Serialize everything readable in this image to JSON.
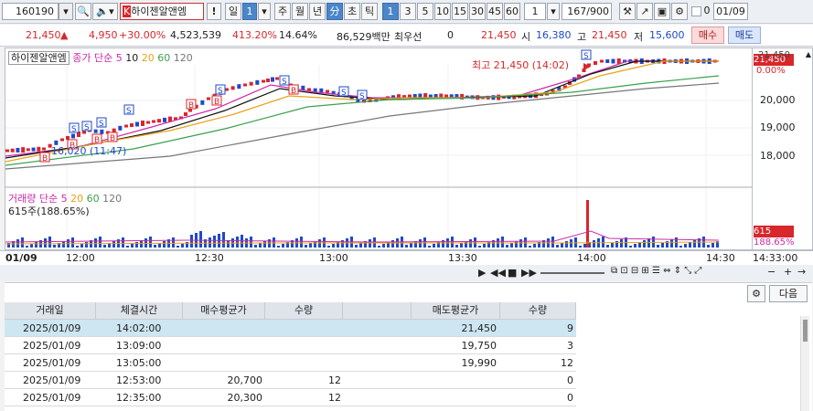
{
  "toolbar": {
    "code": "160190",
    "name": "하이젠알앤엠",
    "periods": [
      "일",
      "1",
      "주",
      "월",
      "년",
      "分",
      "초",
      "틱",
      "1",
      "3",
      "5",
      "10",
      "15",
      "30",
      "45",
      "60",
      "1"
    ],
    "count": "167",
    "count_total": "/900",
    "date": "01/09",
    "checkbox_label": "0"
  },
  "price_line": {
    "price": "21,450",
    "change": "4,950",
    "change_pct": "+30.00%",
    "volume": "4,523,539",
    "vol_ratio": "413.20%",
    "turnover": "14.64%",
    "amount": "86,529백만",
    "min_label": "최우선",
    "min_value": "0",
    "bid": "21,450",
    "open_label": "시",
    "open": "16,380",
    "high_label": "고",
    "high": "21,450",
    "low_label": "저",
    "low": "15,600",
    "buy": "매수",
    "sell": "매도"
  },
  "price_chart": {
    "stock_label": "하이젠알앤엠",
    "legend": [
      "종가 단순 5",
      "10",
      "20",
      "60",
      "120"
    ],
    "high_note": "최고 21,450 (14:02)",
    "low_note": "16,020 (11:47)",
    "y_labels": [
      "21,450",
      "0.00%",
      "20,000",
      "19,000",
      "18,000"
    ],
    "price_tag": "21,450",
    "colors": {
      "ma5": "#cc2aa8",
      "ma10": "#111111",
      "ma20": "#e8a317",
      "ma60": "#3aa14e",
      "ma120": "#777777",
      "up": "#d8262b",
      "down": "#1f49c9"
    }
  },
  "vol_chart": {
    "title": "거래량",
    "legend": [
      "단순 5",
      "20",
      "60",
      "120"
    ],
    "value_note": "615주(188.65%)",
    "tag_value": "615",
    "tag_pct": "188.65%"
  },
  "time_axis": {
    "labels": [
      "01/09",
      "12:00",
      "12:30",
      "13:00",
      "13:30",
      "14:00",
      "14:30",
      "14:33:00"
    ]
  },
  "grid": {
    "next_label": "다음",
    "headers": [
      "거래일",
      "체결시간",
      "매수평균가",
      "수량",
      "",
      "매도평균가",
      "수량"
    ],
    "rows": [
      {
        "date": "2025/01/09",
        "time": "14:02:00",
        "buy_avg": "",
        "buy_qty": "",
        "sell_avg": "21,450",
        "sell_qty": "9"
      },
      {
        "date": "2025/01/09",
        "time": "13:09:00",
        "buy_avg": "",
        "buy_qty": "",
        "sell_avg": "19,750",
        "sell_qty": "3"
      },
      {
        "date": "2025/01/09",
        "time": "13:05:00",
        "buy_avg": "",
        "buy_qty": "",
        "sell_avg": "19,990",
        "sell_qty": "12"
      },
      {
        "date": "2025/01/09",
        "time": "12:53:00",
        "buy_avg": "20,700",
        "buy_qty": "12",
        "sell_avg": "",
        "sell_qty": "0"
      },
      {
        "date": "2025/01/09",
        "time": "12:35:00",
        "buy_avg": "20,300",
        "buy_qty": "12",
        "sell_avg": "",
        "sell_qty": "0"
      }
    ]
  }
}
